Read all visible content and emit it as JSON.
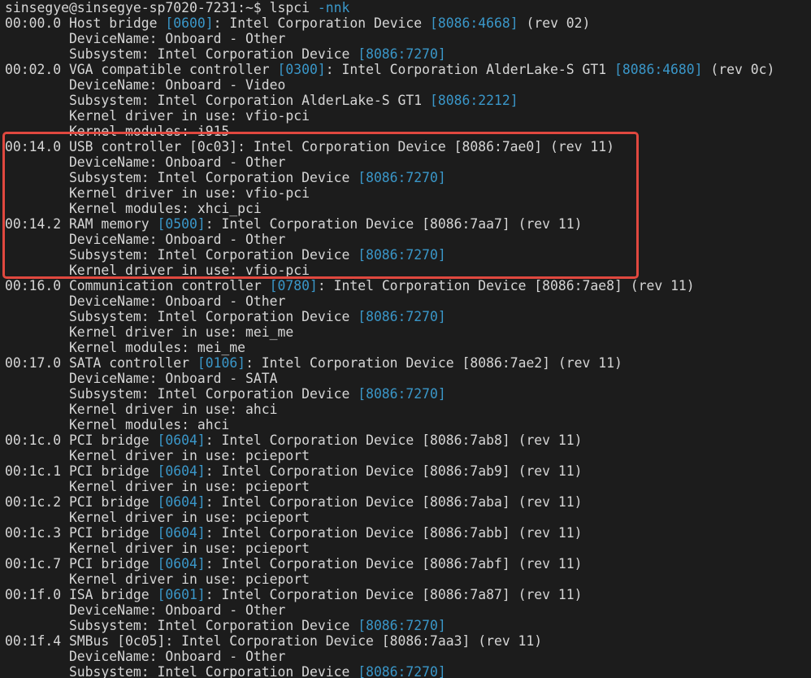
{
  "colors": {
    "background": "#1c1c1c",
    "text": "#d6d6d6",
    "hex_id": "#3a97c9",
    "highlight": "#e0483f"
  },
  "terminal": {
    "prompt": "sinsegye@sinsegye-sp7020-7231:~$ ",
    "command": "lspci -nnk",
    "lines": [
      [
        {
          "t": "sinsegye@sinsegye-sp7020-7231:~$ lspci "
        },
        {
          "t": "-nnk",
          "c": "hex"
        }
      ],
      [
        {
          "t": "00:00.0 Host bridge "
        },
        {
          "t": "[0600]",
          "c": "hex"
        },
        {
          "t": ": Intel Corporation Device "
        },
        {
          "t": "[8086:4668]",
          "c": "hex"
        },
        {
          "t": " (rev 02)"
        }
      ],
      [
        {
          "t": "        DeviceName: Onboard - Other"
        }
      ],
      [
        {
          "t": "        Subsystem: Intel Corporation Device "
        },
        {
          "t": "[8086:7270]",
          "c": "hex"
        }
      ],
      [
        {
          "t": "00:02.0 VGA compatible controller "
        },
        {
          "t": "[0300]",
          "c": "hex"
        },
        {
          "t": ": Intel Corporation AlderLake-S GT1 "
        },
        {
          "t": "[8086:4680]",
          "c": "hex"
        },
        {
          "t": " (rev 0c)"
        }
      ],
      [
        {
          "t": "        DeviceName: Onboard - Video"
        }
      ],
      [
        {
          "t": "        Subsystem: Intel Corporation AlderLake-S GT1 "
        },
        {
          "t": "[8086:2212]",
          "c": "hex"
        }
      ],
      [
        {
          "t": "        Kernel driver in use: vfio-pci"
        }
      ],
      [
        {
          "t": "        Kernel modules: i915"
        }
      ],
      [
        {
          "t": "00:14.0 USB controller [0c03]: Intel Corporation Device [8086:7ae0] (rev 11)"
        }
      ],
      [
        {
          "t": "        DeviceName: Onboard - Other"
        }
      ],
      [
        {
          "t": "        Subsystem: Intel Corporation Device "
        },
        {
          "t": "[8086:7270]",
          "c": "hex"
        }
      ],
      [
        {
          "t": "        Kernel driver in use: vfio-pci"
        }
      ],
      [
        {
          "t": "        Kernel modules: xhci_pci"
        }
      ],
      [
        {
          "t": "00:14.2 RAM memory "
        },
        {
          "t": "[0500]",
          "c": "hex"
        },
        {
          "t": ": Intel Corporation Device [8086:7aa7] (rev 11)"
        }
      ],
      [
        {
          "t": "        DeviceName: Onboard - Other"
        }
      ],
      [
        {
          "t": "        Subsystem: Intel Corporation Device "
        },
        {
          "t": "[8086:7270]",
          "c": "hex"
        }
      ],
      [
        {
          "t": "        Kernel driver in use: vfio-pci"
        }
      ],
      [
        {
          "t": "00:16.0 Communication controller "
        },
        {
          "t": "[0780]",
          "c": "hex"
        },
        {
          "t": ": Intel Corporation Device [8086:7ae8] (rev 11)"
        }
      ],
      [
        {
          "t": "        DeviceName: Onboard - Other"
        }
      ],
      [
        {
          "t": "        Subsystem: Intel Corporation Device "
        },
        {
          "t": "[8086:7270]",
          "c": "hex"
        }
      ],
      [
        {
          "t": "        Kernel driver in use: mei_me"
        }
      ],
      [
        {
          "t": "        Kernel modules: mei_me"
        }
      ],
      [
        {
          "t": "00:17.0 SATA controller "
        },
        {
          "t": "[0106]",
          "c": "hex"
        },
        {
          "t": ": Intel Corporation Device [8086:7ae2] (rev 11)"
        }
      ],
      [
        {
          "t": "        DeviceName: Onboard - SATA"
        }
      ],
      [
        {
          "t": "        Subsystem: Intel Corporation Device "
        },
        {
          "t": "[8086:7270]",
          "c": "hex"
        }
      ],
      [
        {
          "t": "        Kernel driver in use: ahci"
        }
      ],
      [
        {
          "t": "        Kernel modules: ahci"
        }
      ],
      [
        {
          "t": "00:1c.0 PCI bridge "
        },
        {
          "t": "[0604]",
          "c": "hex"
        },
        {
          "t": ": Intel Corporation Device [8086:7ab8] (rev 11)"
        }
      ],
      [
        {
          "t": "        Kernel driver in use: pcieport"
        }
      ],
      [
        {
          "t": "00:1c.1 PCI bridge "
        },
        {
          "t": "[0604]",
          "c": "hex"
        },
        {
          "t": ": Intel Corporation Device [8086:7ab9] (rev 11)"
        }
      ],
      [
        {
          "t": "        Kernel driver in use: pcieport"
        }
      ],
      [
        {
          "t": "00:1c.2 PCI bridge "
        },
        {
          "t": "[0604]",
          "c": "hex"
        },
        {
          "t": ": Intel Corporation Device [8086:7aba] (rev 11)"
        }
      ],
      [
        {
          "t": "        Kernel driver in use: pcieport"
        }
      ],
      [
        {
          "t": "00:1c.3 PCI bridge "
        },
        {
          "t": "[0604]",
          "c": "hex"
        },
        {
          "t": ": Intel Corporation Device [8086:7abb] (rev 11)"
        }
      ],
      [
        {
          "t": "        Kernel driver in use: pcieport"
        }
      ],
      [
        {
          "t": "00:1c.7 PCI bridge "
        },
        {
          "t": "[0604]",
          "c": "hex"
        },
        {
          "t": ": Intel Corporation Device [8086:7abf] (rev 11)"
        }
      ],
      [
        {
          "t": "        Kernel driver in use: pcieport"
        }
      ],
      [
        {
          "t": "00:1f.0 ISA bridge "
        },
        {
          "t": "[0601]",
          "c": "hex"
        },
        {
          "t": ": Intel Corporation Device [8086:7a87] (rev 11)"
        }
      ],
      [
        {
          "t": "        DeviceName: Onboard - Other"
        }
      ],
      [
        {
          "t": "        Subsystem: Intel Corporation Device "
        },
        {
          "t": "[8086:7270]",
          "c": "hex"
        }
      ],
      [
        {
          "t": "00:1f.4 SMBus [0c05]: Intel Corporation Device [8086:7aa3] (rev 11)"
        }
      ],
      [
        {
          "t": "        DeviceName: Onboard - Other"
        }
      ],
      [
        {
          "t": "        Subsystem: Intel Corporation Device "
        },
        {
          "t": "[8086:7270]",
          "c": "hex"
        }
      ]
    ]
  }
}
